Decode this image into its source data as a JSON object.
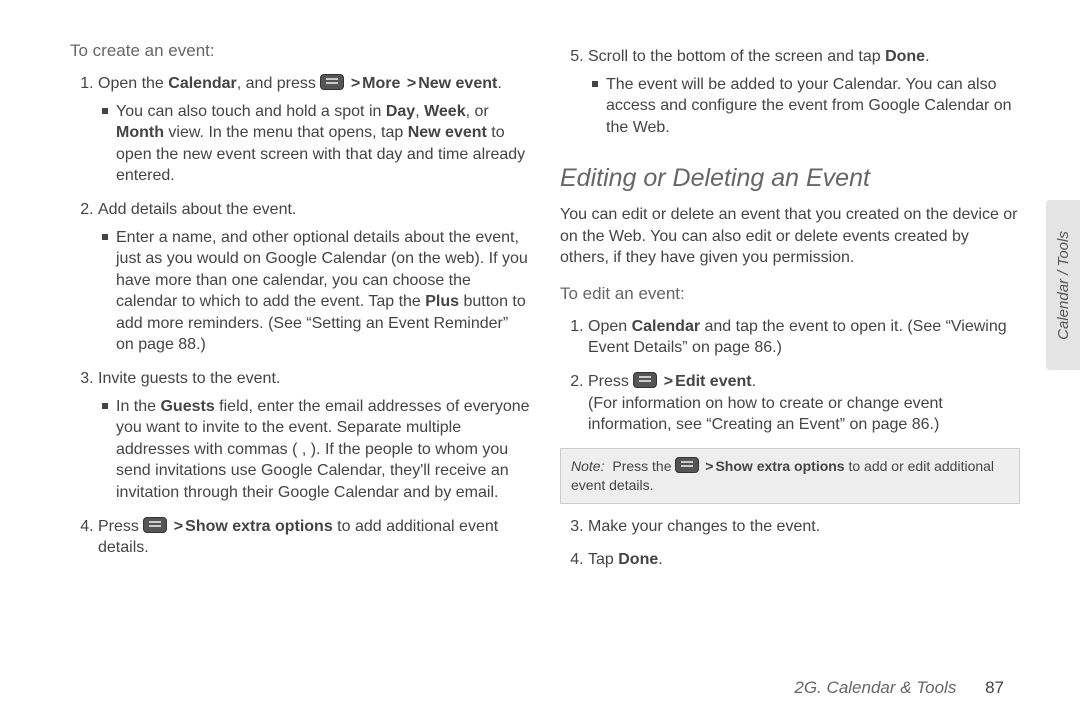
{
  "left": {
    "lead": "To create an event:",
    "step1a": "Open the ",
    "step1b": "Calendar",
    "step1c": ", and press ",
    "step1_path1": "More",
    "step1_path2": "New event",
    "step1_end": ".",
    "step1_sub_a": "You can also touch and hold a spot in ",
    "step1_sub_b": "Day",
    "step1_sub_c": ", ",
    "step1_sub_d": "Week",
    "step1_sub_e": ", or ",
    "step1_sub_f": "Month",
    "step1_sub_g": " view. In the menu that opens, tap ",
    "step1_sub_h": "New event",
    "step1_sub_i": " to open the new event screen with that day and time already entered.",
    "step2": "Add details about the event.",
    "step2_sub_a": "Enter a name, and other optional details about the event, just as you would on Google Calendar (on the web). If you have more than one calendar, you can choose the calendar to which to add the event. Tap the ",
    "step2_sub_b": "Plus",
    "step2_sub_c": " button to add more reminders. (See “Setting an Event Reminder” on page 88.)",
    "step3": "Invite guests to the event.",
    "step3_sub_a": "In the ",
    "step3_sub_b": "Guests",
    "step3_sub_c": " field, enter the email addresses of everyone you want to invite to the event. Separate multiple addresses with commas ( , ). If the people to whom you send invitations use Google Calendar, they'll receive an invitation through their Google Calendar and by email.",
    "step4a": "Press ",
    "step4b": "Show extra options",
    "step4c": " to add additional event details."
  },
  "right": {
    "step5a": "Scroll to the bottom of the screen and tap ",
    "step5b": "Done",
    "step5c": ".",
    "step5_sub": "The event will be added to your Calendar. You can also access and configure the event from Google Calendar on the Web.",
    "heading": "Editing or Deleting an Event",
    "intro": "You can edit or delete an event that you created on the device or on the Web. You can also edit or delete events created by others, if they have given you permission.",
    "lead2": "To edit an event:",
    "e1a": "Open ",
    "e1b": "Calendar",
    "e1c": " and tap the event to open it. (See “Viewing Event Details” on page 86.)",
    "e2a": "Press ",
    "e2b": "Edit event",
    "e2c": ".",
    "e2d": "(For information on how to create or change event information, see “Creating an Event” on page 86.)",
    "note_label": "Note:",
    "note_a": "Press the ",
    "note_b": "Show extra options",
    "note_c": " to add or edit additional event details.",
    "e3": "Make your changes to the event.",
    "e4a": "Tap ",
    "e4b": "Done",
    "e4c": "."
  },
  "footer": {
    "section": "2G. Calendar & Tools",
    "page": "87"
  },
  "tab": "Calendar / Tools"
}
